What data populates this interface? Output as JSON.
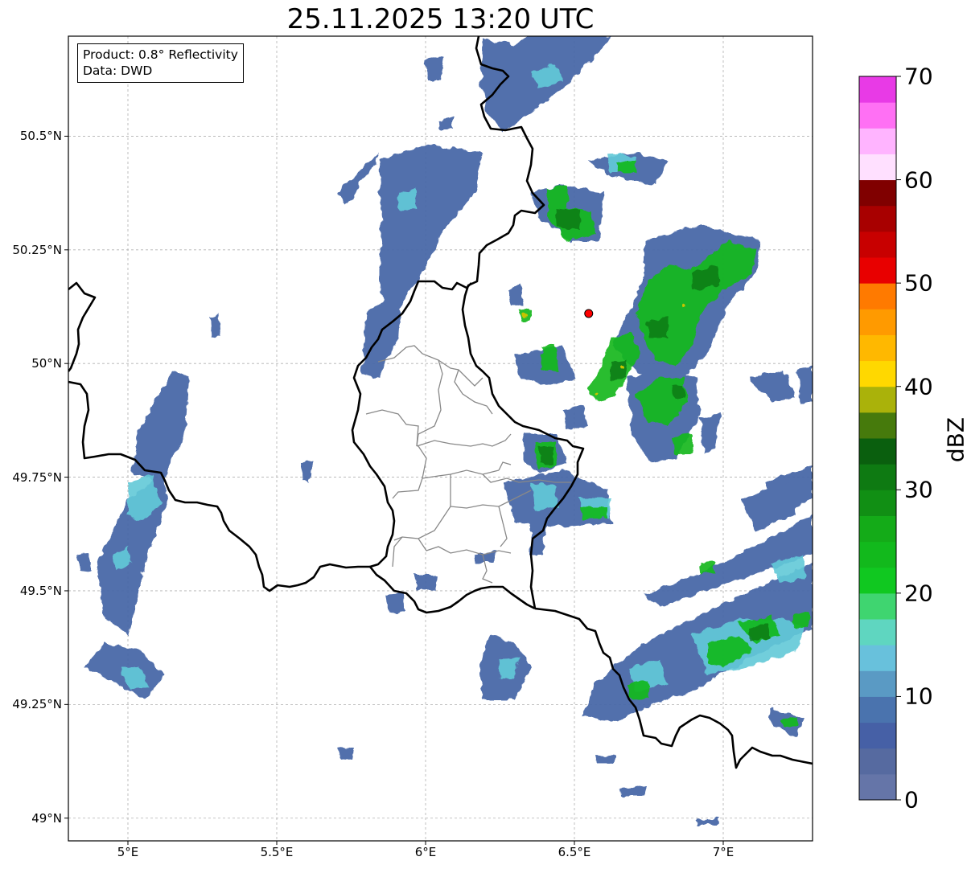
{
  "title": "25.11.2025 13:20 UTC",
  "info": {
    "product": "Product: 0.8° Reflectivity",
    "data": "Data: DWD"
  },
  "map": {
    "lon_range": [
      4.8,
      7.3
    ],
    "lat_range": [
      48.95,
      50.72
    ],
    "lon_ticks": [
      {
        "value": 5.0,
        "label": "5°E"
      },
      {
        "value": 5.5,
        "label": "5.5°E"
      },
      {
        "value": 6.0,
        "label": "6°E"
      },
      {
        "value": 6.5,
        "label": "6.5°E"
      },
      {
        "value": 7.0,
        "label": "7°E"
      }
    ],
    "lat_ticks": [
      {
        "value": 50.5,
        "label": "50.5°N"
      },
      {
        "value": 50.25,
        "label": "50.25°N"
      },
      {
        "value": 50.0,
        "label": "50°N"
      },
      {
        "value": 49.75,
        "label": "49.75°N"
      },
      {
        "value": 49.5,
        "label": "49.5°N"
      },
      {
        "value": 49.25,
        "label": "49.25°N"
      },
      {
        "value": 49.0,
        "label": "49°N"
      }
    ],
    "gridlines": true,
    "radar_site": {
      "lon": 6.548,
      "lat": 50.11,
      "color": "#ff0000"
    }
  },
  "colorbar": {
    "unit": "dBZ",
    "min": 0,
    "max": 70,
    "step": 2.5,
    "colors": [
      "#6575a8",
      "#566aa0",
      "#4660a6",
      "#4a73ae",
      "#5a9ac4",
      "#68c1dc",
      "#5fd6c0",
      "#3fd570",
      "#10c820",
      "#12b91c",
      "#14ab18",
      "#118f14",
      "#0e7a12",
      "#0a5f0e",
      "#467a0c",
      "#aab20a",
      "#ffd800",
      "#ffb800",
      "#ff9a00",
      "#ff7a00",
      "#e80000",
      "#c80000",
      "#a80000",
      "#800000",
      "#ffe0ff",
      "#ffb4ff",
      "#ff70f4",
      "#e83ae6"
    ],
    "ticks": [
      {
        "value": 0,
        "label": "0"
      },
      {
        "value": 10,
        "label": "10"
      },
      {
        "value": 20,
        "label": "20"
      },
      {
        "value": 30,
        "label": "30"
      },
      {
        "value": 40,
        "label": "40"
      },
      {
        "value": 50,
        "label": "50"
      },
      {
        "value": 60,
        "label": "60"
      },
      {
        "value": 70,
        "label": "70"
      }
    ]
  },
  "echo_colors": {
    "weak": "#4a69a8",
    "light": "#5a9ac4",
    "cyan": "#62c9d8",
    "green": "#14b81e",
    "dark_green": "#0a7a12",
    "yellow_core": "#c8c400"
  }
}
